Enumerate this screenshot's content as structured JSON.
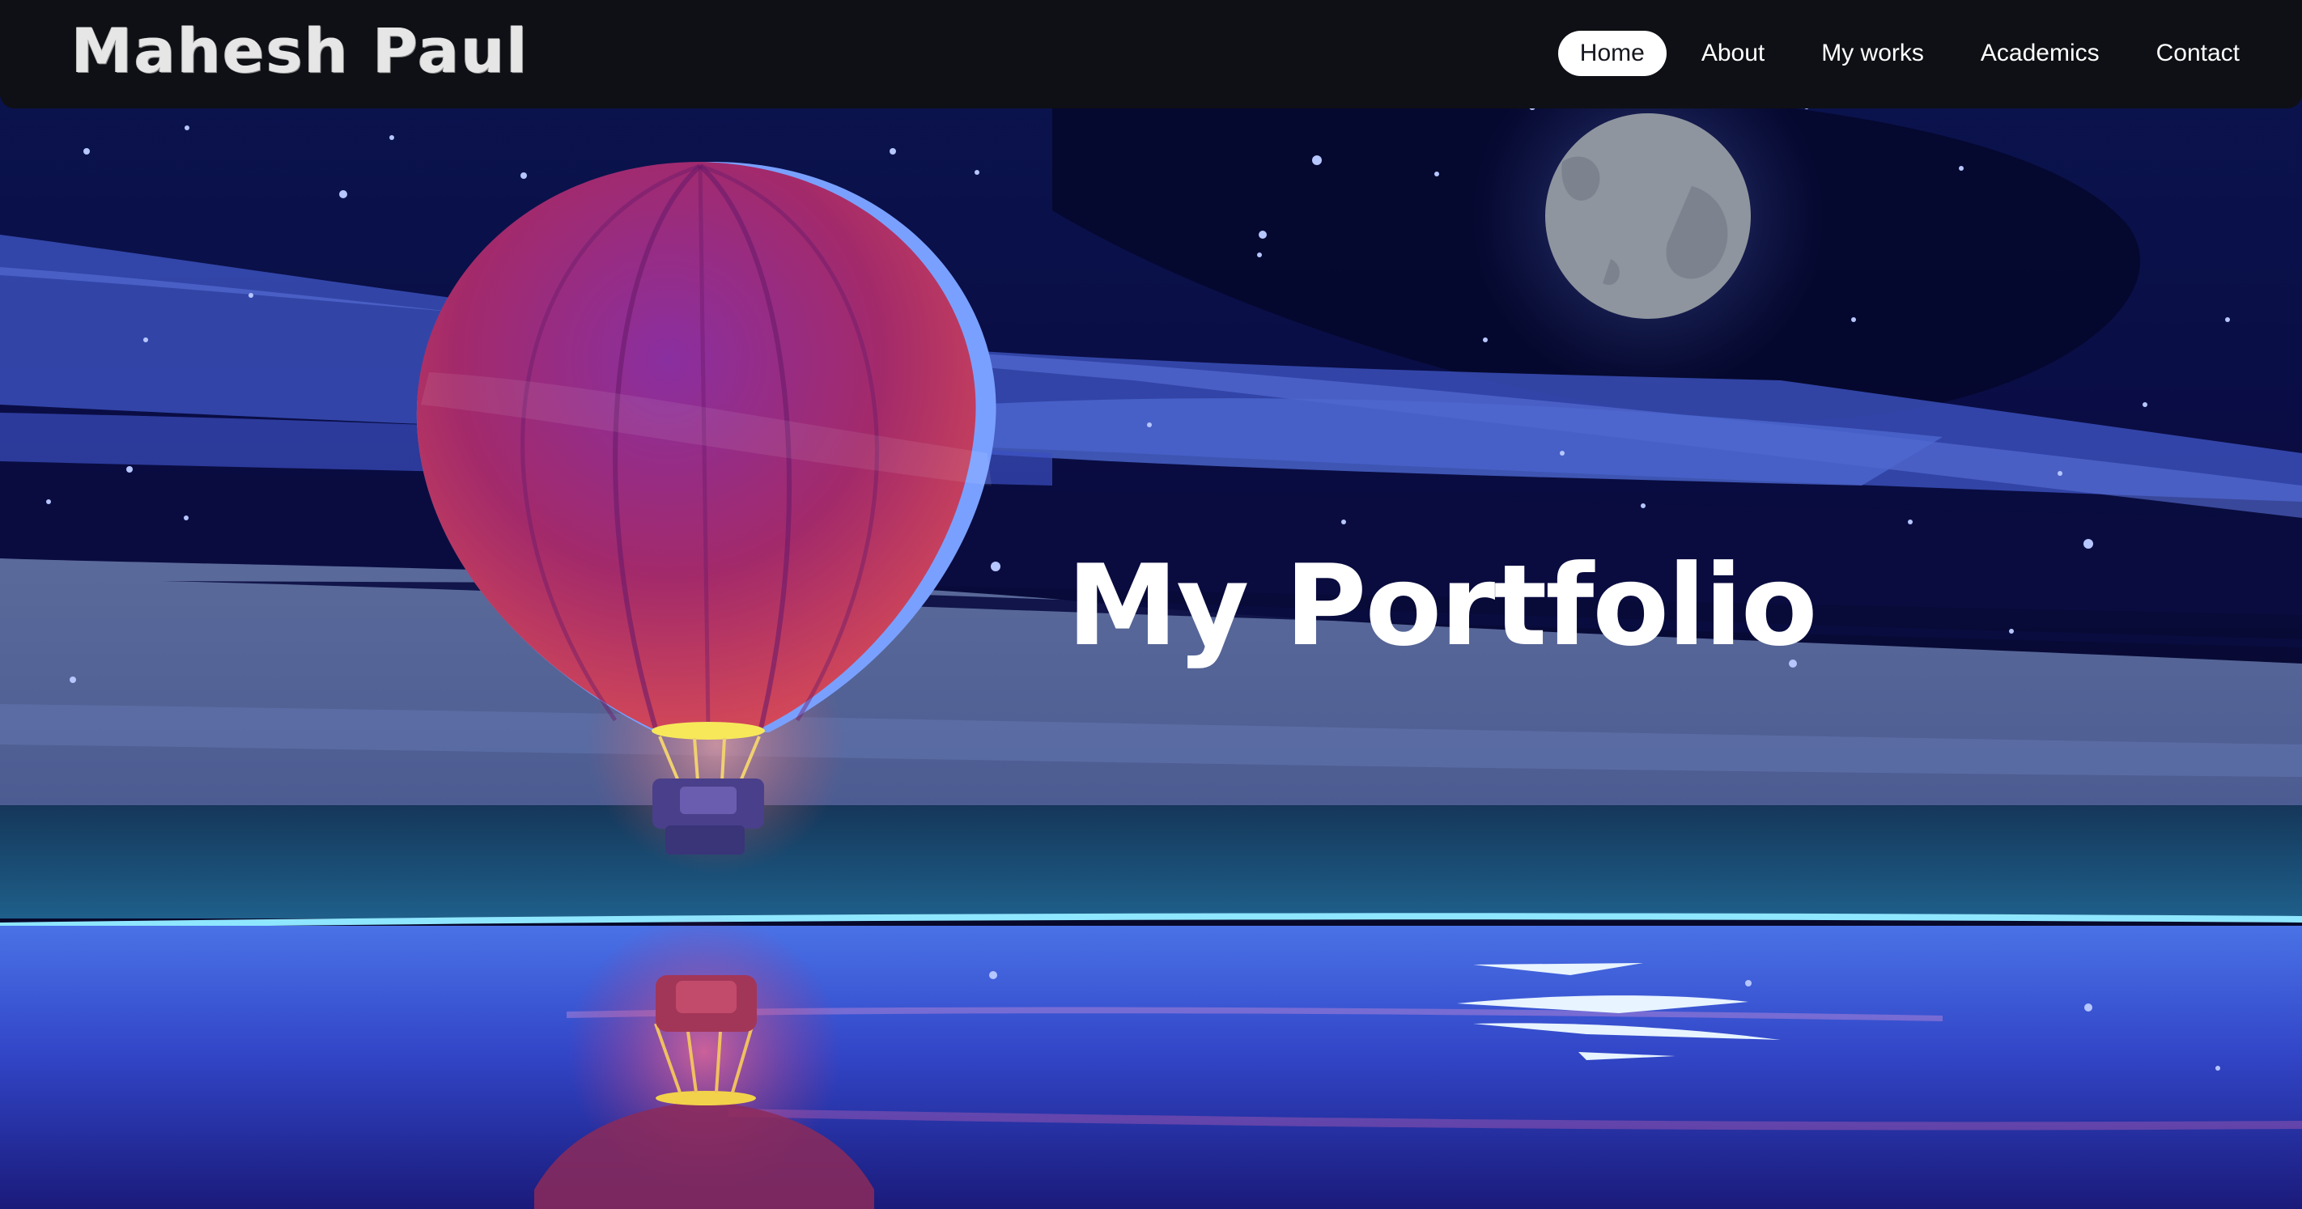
{
  "brand": {
    "name": "Mahesh Paul"
  },
  "nav": {
    "items": [
      {
        "label": "Home",
        "active": true
      },
      {
        "label": "About",
        "active": false
      },
      {
        "label": "My works",
        "active": false
      },
      {
        "label": "Academics",
        "active": false
      },
      {
        "label": "Contact",
        "active": false
      }
    ]
  },
  "hero": {
    "title": "My Portfolio",
    "illustration": {
      "icons": [
        "hot-air-balloon-icon",
        "moon-icon",
        "stars-icon",
        "balloon-reflection-icon"
      ]
    }
  },
  "colors": {
    "navbar_bg": "#0e1015",
    "sky_dark": "#07082a",
    "sky_blue": "#3a4fb8",
    "water_blue": "#3c5be0",
    "balloon_red": "#c4324a",
    "balloon_purple": "#7a2a8c",
    "moon": "#8f959f",
    "active_tab_bg": "#ffffff"
  }
}
